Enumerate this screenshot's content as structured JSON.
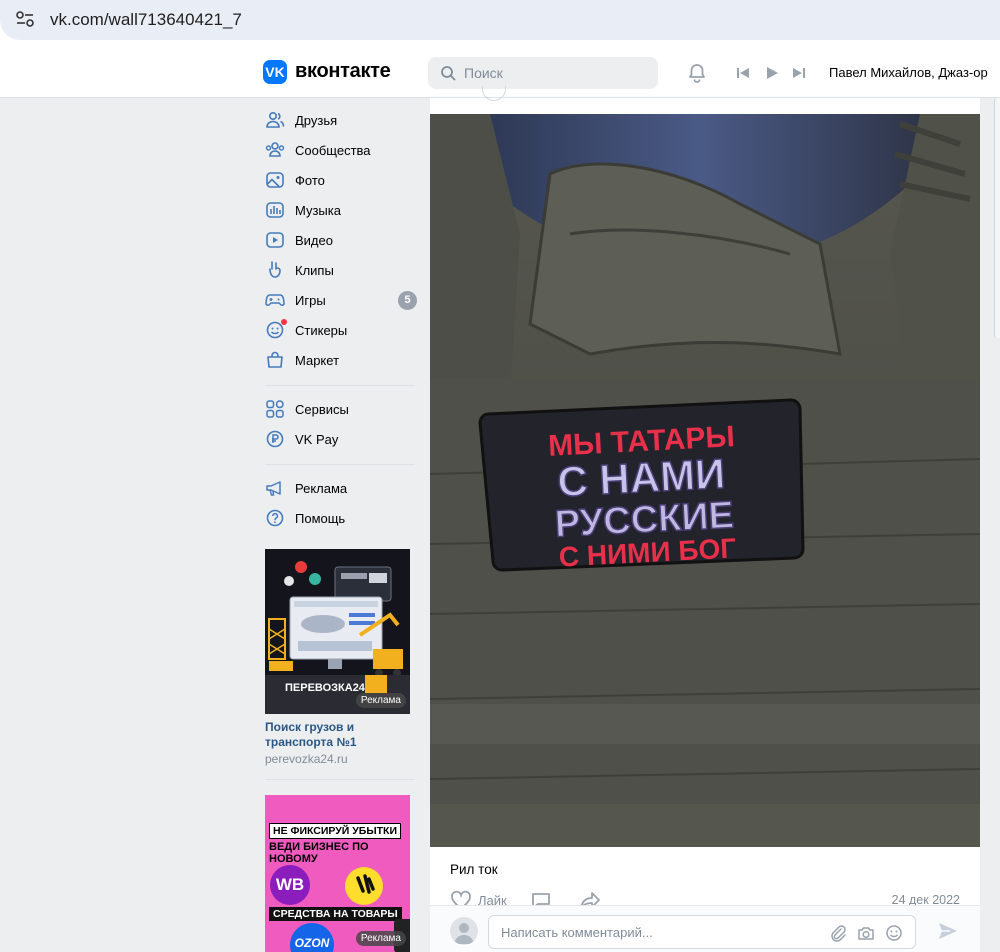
{
  "browser": {
    "url": "vk.com/wall713640421_7"
  },
  "header": {
    "logo_mark": "VK",
    "logo_text": "вконтакте",
    "search_placeholder": "Поиск",
    "now_playing": "Павел Михайлов, Джаз-ор"
  },
  "sidebar": {
    "items": [
      {
        "label": "Друзья",
        "icon": "friends-icon"
      },
      {
        "label": "Сообщества",
        "icon": "communities-icon"
      },
      {
        "label": "Фото",
        "icon": "photo-icon"
      },
      {
        "label": "Музыка",
        "icon": "music-icon"
      },
      {
        "label": "Видео",
        "icon": "video-icon"
      },
      {
        "label": "Клипы",
        "icon": "clips-icon"
      },
      {
        "label": "Игры",
        "icon": "games-icon",
        "badge": "5"
      },
      {
        "label": "Стикеры",
        "icon": "stickers-icon"
      },
      {
        "label": "Маркет",
        "icon": "market-icon"
      },
      {
        "label": "Сервисы",
        "icon": "services-icon"
      },
      {
        "label": "VK Pay",
        "icon": "vkpay-icon"
      },
      {
        "label": "Реклама",
        "icon": "ads-icon"
      },
      {
        "label": "Помощь",
        "icon": "help-icon"
      }
    ]
  },
  "ads": [
    {
      "image_brand": "ПЕРЕВОЗКА24",
      "badge": "Реклама",
      "title": "Поиск грузов и транспорта №1",
      "domain": "perevozka24.ru"
    },
    {
      "headline": "НЕ ФИКСИРУЙ УБЫТКИ",
      "subline": "ВЕДИ БИЗНЕС ПО НОВОМУ",
      "goods": "СРЕДСТВА НА ТОВАРЫ",
      "wb": "WB",
      "ozon": "OZON",
      "badge": "Реклама"
    }
  ],
  "post": {
    "patch_lines": [
      "МЫ ТАТАРЫ",
      "С НАМИ",
      "РУССКИЕ",
      "С НИМИ БОГ"
    ],
    "text": "Рил ток",
    "like_label": "Лайк",
    "date": "24 дек 2022",
    "comment_placeholder": "Написать комментарий..."
  },
  "colors": {
    "accent": "#0077ff",
    "link": "#2a5885",
    "badge": "#99a2ad",
    "patch_red": "#e8304b"
  }
}
